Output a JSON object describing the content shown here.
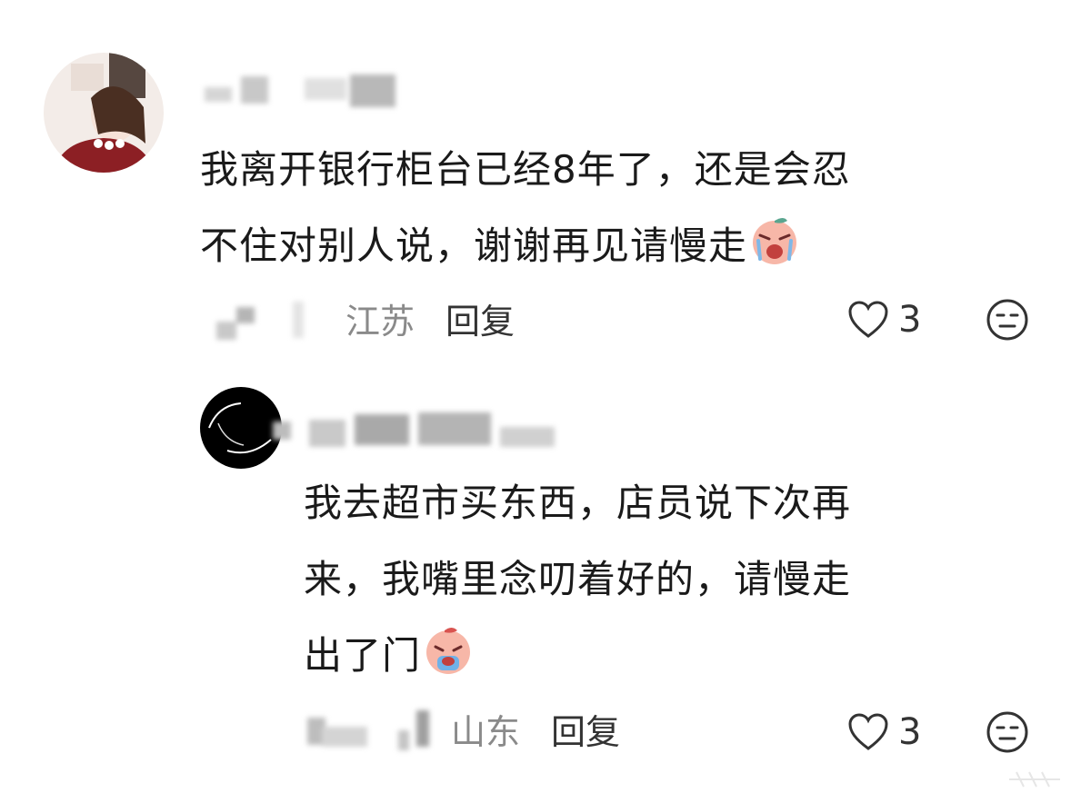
{
  "comments": [
    {
      "text_line1": "我离开银行柜台已经8年了，还是会忍",
      "text_line2": "不住对别人说，谢谢再见请慢走",
      "location": "江苏",
      "reply_label": "回复",
      "likes": "3",
      "emoji_icon": "crying-face-emoji-icon"
    },
    {
      "text_line1": "我去超市买东西，店员说下次再",
      "text_line2": "来，我嘴里念叨着好的，请慢走",
      "text_line3": "出了门",
      "location": "山东",
      "reply_label": "回复",
      "likes": "3",
      "emoji_icon": "crying-face-emoji-icon"
    }
  ],
  "colors": {
    "text": "#1a1a1a",
    "location": "#8a8a8a",
    "icon": "#333333"
  }
}
